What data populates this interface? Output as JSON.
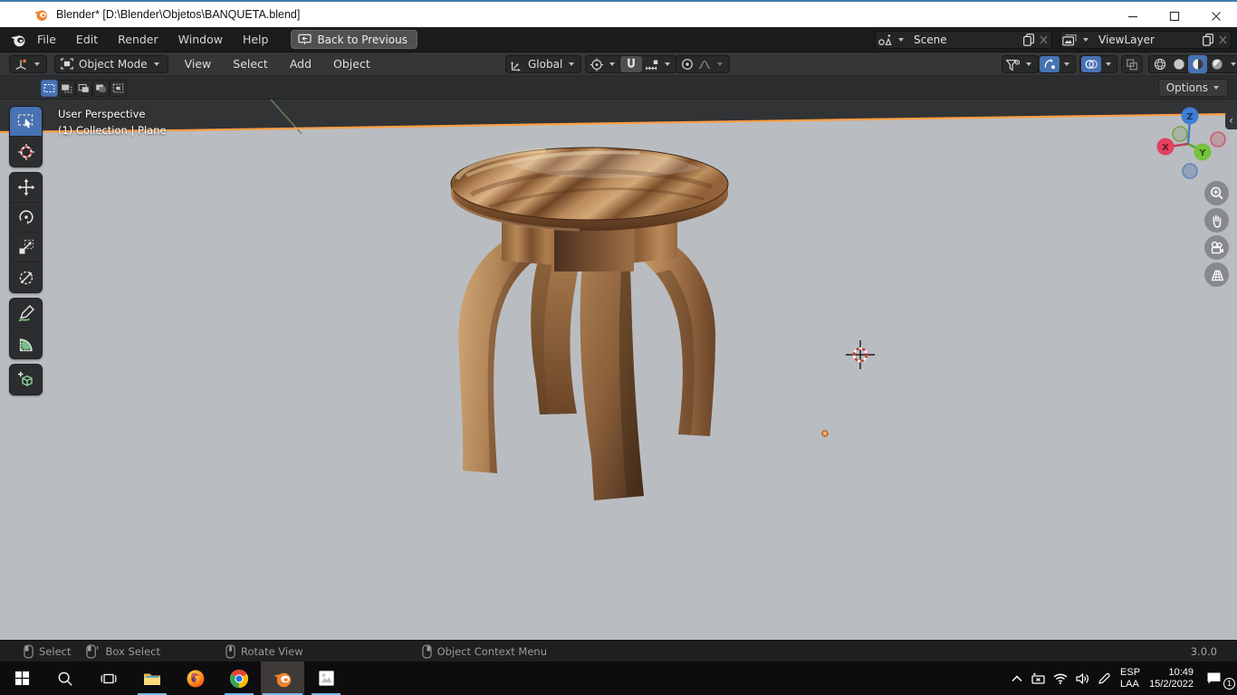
{
  "window": {
    "title": "Blender* [D:\\Blender\\Objetos\\BANQUETA.blend]"
  },
  "topbar": {
    "menus": [
      "File",
      "Edit",
      "Render",
      "Window",
      "Help"
    ],
    "back_button_label": "Back to Previous",
    "scene_selector": {
      "value": "Scene"
    },
    "view_layer_selector": {
      "value": "ViewLayer"
    }
  },
  "viewport_header": {
    "mode_label": "Object Mode",
    "menus": [
      "View",
      "Select",
      "Add",
      "Object"
    ],
    "orientation_label": "Global"
  },
  "tool_settings": {
    "options_label": "Options"
  },
  "viewport": {
    "overlay": {
      "line1": "User Perspective",
      "line2": "(1) Collection | Plane"
    },
    "axis_gizmo": {
      "x": "X",
      "y": "Y",
      "z": "Z"
    }
  },
  "statusbar": {
    "hints": [
      {
        "icon": "mouse-left",
        "label": "Select"
      },
      {
        "icon": "mouse-left-drag",
        "label": "Box Select"
      },
      {
        "icon": "mouse-middle",
        "label": "Rotate View"
      },
      {
        "icon": "mouse-right",
        "label": "Object Context Menu"
      }
    ],
    "version": "3.0.0"
  },
  "taskbar": {
    "tray": {
      "language_line1": "ESP",
      "language_line2": "LAA",
      "time": "10:49",
      "date": "15/2/2022",
      "notification_count": "1"
    }
  },
  "colors": {
    "accent_blue": "#4772b3",
    "selection_orange": "#ff9e45",
    "viewport_floor": "#b9bdc1",
    "viewport_sky": "#323335",
    "taskbar_underline": "#76b9ed"
  }
}
